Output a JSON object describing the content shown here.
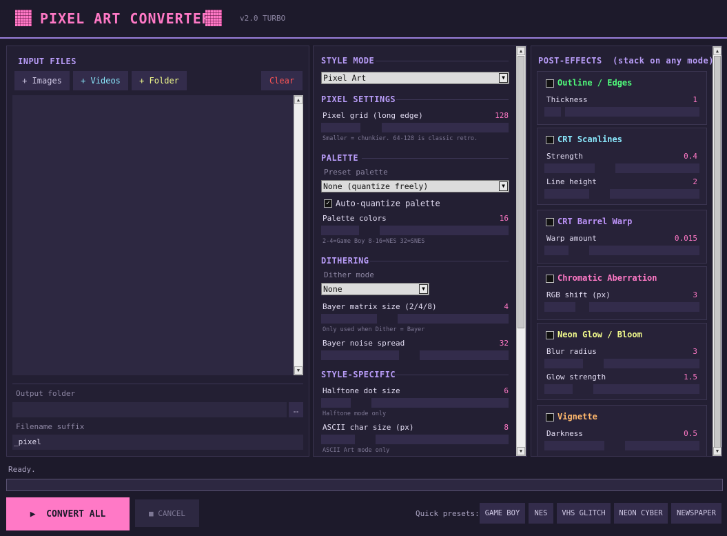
{
  "header": {
    "title": "PIXEL ART CONVERTER",
    "version": "v2.0 TURBO"
  },
  "input_panel": {
    "title": "INPUT FILES",
    "add_images": "+ Images",
    "add_videos": "+ Videos",
    "add_folder": "+ Folder",
    "clear": "Clear",
    "output_folder_label": "Output folder",
    "output_folder_value": "",
    "browse_label": "…",
    "suffix_label": "Filename suffix",
    "suffix_value": "_pixel"
  },
  "settings_panel": {
    "style_mode_title": "STYLE MODE",
    "style_mode_value": "Pixel Art",
    "pixel_settings_title": "PIXEL SETTINGS",
    "pixel_grid_label": "Pixel grid (long edge)",
    "pixel_grid_value": "128",
    "pixel_grid_hint": "Smaller = chunkier.  64-128 is classic retro.",
    "palette_title": "PALETTE",
    "preset_palette_label": "Preset palette",
    "preset_palette_value": "None (quantize freely)",
    "auto_quantize_label": "Auto-quantize palette",
    "palette_colors_label": "Palette colors",
    "palette_colors_value": "16",
    "palette_colors_hint": "2-4=Game Boy  8-16=NES  32=SNES",
    "dithering_title": "DITHERING",
    "dither_mode_label": "Dither mode",
    "dither_mode_value": "None",
    "bayer_size_label": "Bayer matrix size (2/4/8)",
    "bayer_size_value": "4",
    "bayer_size_hint": "Only used when Dither = Bayer",
    "bayer_noise_label": "Bayer noise spread",
    "bayer_noise_value": "32",
    "style_specific_title": "STYLE-SPECIFIC",
    "halftone_label": "Halftone dot size",
    "halftone_value": "6",
    "halftone_hint": "Halftone mode only",
    "ascii_label": "ASCII char size (px)",
    "ascii_value": "8",
    "ascii_hint": "ASCII Art mode only"
  },
  "effects_panel": {
    "title": "POST-EFFECTS  (stack on any mode)",
    "effects": [
      {
        "name": "Outline / Edges",
        "color": "#50fa7b",
        "params": [
          {
            "label": "Thickness",
            "value": "1"
          }
        ]
      },
      {
        "name": "CRT Scanlines",
        "color": "#8be9fd",
        "params": [
          {
            "label": "Strength",
            "value": "0.4"
          },
          {
            "label": "Line height",
            "value": "2"
          }
        ]
      },
      {
        "name": "CRT Barrel Warp",
        "color": "#bd93f9",
        "params": [
          {
            "label": "Warp amount",
            "value": "0.015"
          }
        ]
      },
      {
        "name": "Chromatic Aberration",
        "color": "#ff79c6",
        "params": [
          {
            "label": "RGB shift (px)",
            "value": "3"
          }
        ]
      },
      {
        "name": "Neon Glow / Bloom",
        "color": "#f1fa8c",
        "params": [
          {
            "label": "Blur radius",
            "value": "3"
          },
          {
            "label": "Glow strength",
            "value": "1.5"
          }
        ]
      },
      {
        "name": "Vignette",
        "color": "#ffb86c",
        "params": [
          {
            "label": "Darkness",
            "value": "0.5"
          }
        ]
      }
    ]
  },
  "status": {
    "text": "Ready."
  },
  "footer": {
    "convert_label": "▶  CONVERT ALL",
    "cancel_label": "■ CANCEL",
    "quick_presets_label": "Quick presets:",
    "presets": [
      "GAME BOY",
      "NES",
      "VHS GLITCH",
      "NEON CYBER",
      "NEWSPAPER"
    ]
  }
}
